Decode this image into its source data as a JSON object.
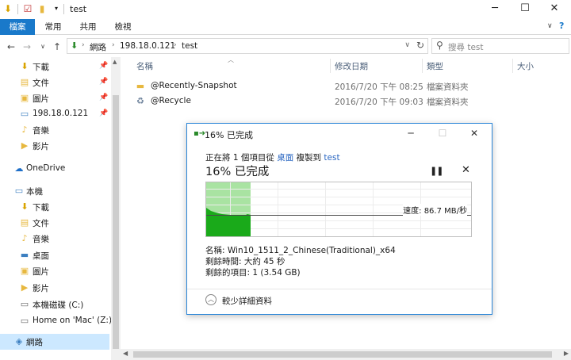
{
  "window": {
    "title": "test",
    "minimize_icon": "minimize-icon",
    "maximize_icon": "maximize-icon",
    "close_icon": "close-icon"
  },
  "ribbon": {
    "tabs": [
      {
        "label": "檔案",
        "active": true
      },
      {
        "label": "常用",
        "active": false
      },
      {
        "label": "共用",
        "active": false
      },
      {
        "label": "檢視",
        "active": false
      }
    ]
  },
  "address": {
    "crumbs": [
      "網路",
      "198.18.0.121",
      "test"
    ]
  },
  "search": {
    "placeholder": "搜尋 test"
  },
  "nav_pane": {
    "quick_access": [
      {
        "label": "下載",
        "icon": "download-folder-icon",
        "pinned": true
      },
      {
        "label": "文件",
        "icon": "documents-folder-icon",
        "pinned": true
      },
      {
        "label": "圖片",
        "icon": "pictures-folder-icon",
        "pinned": true
      },
      {
        "label": "198.18.0.121",
        "icon": "network-computer-icon",
        "pinned": true
      },
      {
        "label": "音樂",
        "icon": "music-folder-icon",
        "pinned": false
      },
      {
        "label": "影片",
        "icon": "videos-folder-icon",
        "pinned": false
      }
    ],
    "onedrive": "OneDrive",
    "this_pc": "本機",
    "this_pc_items": [
      {
        "label": "下載",
        "icon": "download-folder-icon"
      },
      {
        "label": "文件",
        "icon": "documents-folder-icon"
      },
      {
        "label": "音樂",
        "icon": "music-folder-icon"
      },
      {
        "label": "桌面",
        "icon": "desktop-folder-icon"
      },
      {
        "label": "圖片",
        "icon": "pictures-folder-icon"
      },
      {
        "label": "影片",
        "icon": "videos-folder-icon"
      },
      {
        "label": "本機磁碟 (C:)",
        "icon": "local-disk-icon"
      },
      {
        "label": "Home on 'Mac' (Z:)",
        "icon": "network-drive-icon"
      }
    ],
    "network": "網路"
  },
  "columns": {
    "name": "名稱",
    "date": "修改日期",
    "type": "類型",
    "size": "大小"
  },
  "files": [
    {
      "name": "@Recently-Snapshot",
      "date": "2016/7/20 下午 08:25",
      "type": "檔案資料夾",
      "icon": "folder-icon"
    },
    {
      "name": "@Recycle",
      "date": "2016/7/20 下午 09:03",
      "type": "檔案資料夾",
      "icon": "recycle-folder-icon"
    }
  ],
  "copy_dialog": {
    "title": "16% 已完成",
    "line_prefix": "正在將 1 個項目從",
    "source": "桌面",
    "line_middle": "複製到",
    "destination": "test",
    "percent_text": "16% 已完成",
    "progress": 0.16,
    "speed_text": "速度: 86.7 MB/秒",
    "name_text": "名稱: Win10_1511_2_Chinese(Traditional)_x64",
    "time_remaining": "剩餘時間: 大約 45 秒",
    "items_remaining": "剩餘的項目: 1 (3.54 GB)",
    "less_details": "較少詳細資料"
  },
  "colors": {
    "accent": "#1979ca",
    "graph_fill": "#a9e3a2",
    "graph_speed": "#1aaa1a",
    "selection": "#cce8ff"
  }
}
